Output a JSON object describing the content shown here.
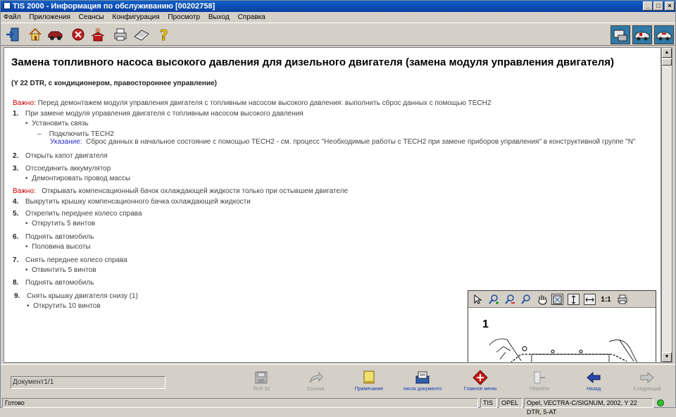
{
  "window": {
    "title": "TIS 2000 - Информация по обслуживанию [00202758]"
  },
  "menu": [
    "Файл",
    "Приложения",
    "Сеансы",
    "Конфигурация",
    "Просмотр",
    "Выход",
    "Справка"
  ],
  "document": {
    "title": "Замена топливного насоса высокого давления для дизельного двигателя (замена модуля управления двигателя)",
    "subtitle": "(Y 22 DTR, с кондиционером, правостороннее управление)",
    "warn_label": "Важно:",
    "warn1": "Перед демонтажем модуля управления двигателя с топливным насосом высокого давления: выполнить сброс данных с помощью TECH2",
    "steps": [
      {
        "num": "1.",
        "text": "При замене модуля управления двигателя с топливным насосом высокого давления"
      },
      {
        "num": "2.",
        "text": "Открыть капот двигателя"
      },
      {
        "num": "3.",
        "text": "Отсоединить аккумулятор"
      },
      {
        "num": "4.",
        "text": "Выкрутить крышку компенсационного бачка охлаждающей жидкости"
      },
      {
        "num": "5.",
        "text": "Открепить переднее колесо справа"
      },
      {
        "num": "6.",
        "text": "Поднять автомобиль"
      },
      {
        "num": "7.",
        "text": "Снять переднее колесо справа"
      },
      {
        "num": "8.",
        "text": "Поднять автомобиль"
      },
      {
        "num": "9.",
        "text": "Снять крышку двигателя снизу (1)"
      }
    ],
    "sub1": "Установить связь",
    "dash": "–",
    "sub1a": "Подключить TECH2",
    "note_label": "Указание:",
    "note": "Сброс данных в начальное состояние с помощью TECH2 - см. процесс \"Необходимые работы с TECH2 при замене приборов управления\" в конструктивной группе \"N\"",
    "sub3": "Демонтировать провод массы",
    "warn2": "Открывать компенсационный бачок охлаждающей жидкости только при остывшем двигателе",
    "sub5": "Открутить 5 винтов",
    "sub6": "Половина высоты",
    "sub7": "Отвинтить 5 винтов",
    "sub9": "Открутить 10 винтов"
  },
  "image_viewer": {
    "zoom_label": "1:1",
    "figure_number": "1"
  },
  "bottom": {
    "doc_field": "Документ1/1",
    "buttons": [
      "Tech 32",
      "Ссылка",
      "Примечание",
      "писок документо",
      "Главное меню",
      "Перейти",
      "Назад",
      "Следующий"
    ]
  },
  "status": {
    "ready": "Готово",
    "tis": "TIS",
    "brand": "OPEL",
    "vehicle": "Opel, VECTRA-C/SIGNUM, 2002, Y 22 DTR, 5-AT"
  },
  "colors": {
    "warning": "#cc0000",
    "note": "#2b2bd0",
    "titlebar": "#0a3fa0"
  }
}
